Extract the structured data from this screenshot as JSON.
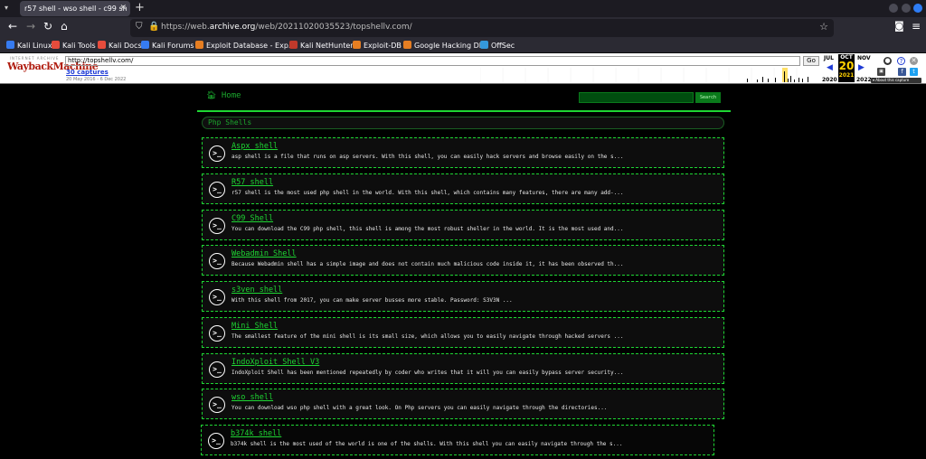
{
  "browser": {
    "tab_title": "r57 shell - wso shell - c99 sh",
    "url_prefix": "https://web.",
    "url_domain": "archive.org",
    "url_rest": "/web/20211020035523/topshellv.com/",
    "bookmarks": [
      {
        "label": "Kali Linux",
        "icon": "kali-icon",
        "color": "#367bf0"
      },
      {
        "label": "Kali Tools",
        "icon": "kali-tools-icon",
        "color": "#e74c3c"
      },
      {
        "label": "Kali Docs",
        "icon": "kali-docs-icon",
        "color": "#e74c3c"
      },
      {
        "label": "Kali Forums",
        "icon": "kali-forums-icon",
        "color": "#367bf0"
      },
      {
        "label": "Exploit Database - Exp...",
        "icon": "exploit-db-icon",
        "color": "#e67e22"
      },
      {
        "label": "Kali NetHunter",
        "icon": "nethunter-icon",
        "color": "#c0392b"
      },
      {
        "label": "Exploit-DB",
        "icon": "exploit-db-icon",
        "color": "#e67e22"
      },
      {
        "label": "Google Hacking DB",
        "icon": "ghdb-icon",
        "color": "#e67e22"
      },
      {
        "label": "OffSec",
        "icon": "offsec-icon",
        "color": "#3498db"
      }
    ]
  },
  "wayback": {
    "logo_top": "INTERNET ARCHIVE",
    "logo_main": "WaybackMachine",
    "url_value": "http://topshellv.com/",
    "go_label": "Go",
    "captures_label": "30 captures",
    "date_range": "20 May 2016 - 6 Dec 2022",
    "prev_month": "JUL",
    "cur_month": "OCT",
    "next_month": "NOV",
    "cur_day": "20",
    "prev_year": "2020",
    "cur_year": "2021",
    "next_year": "2022",
    "about_label": "About this capture"
  },
  "page": {
    "home_label": "Home",
    "search_label": "Search",
    "section_title": "Php Shells",
    "shells": [
      {
        "title": "Aspx shell",
        "desc": "asp shell is a file that runs on asp servers. With this shell, you can easily hack servers and browse easily on the s..."
      },
      {
        "title": "R57 shell",
        "desc": "r57 shell is the most used php shell in the world. With this shell, which contains many features, there are many add-..."
      },
      {
        "title": "C99 Shell",
        "desc": "You can download the C99 php shell, this shell is among the most robust sheller in the world. It is the most used and..."
      },
      {
        "title": "Webadmin Shell",
        "desc": "Because Webadmin shell has a simple image and does not contain much malicious code inside it, it has been observed th..."
      },
      {
        "title": "s3ven shell",
        "desc": "With this shell from 2017, you can make server busses more stable. Password: S3V3N ..."
      },
      {
        "title": "Mini Shell",
        "desc": "The smallest feature of the mini shell is its small size, which allows you to easily navigate through hacked servers ..."
      },
      {
        "title": "IndoXploit Shell V3",
        "desc": "IndoXploit Shell has been mentioned repeatedly by coder who writes that it will you can easily bypass server security..."
      },
      {
        "title": "wso shell",
        "desc": "You can download wso php shell with a great look. On Php servers you can easily navigate through the directories..."
      },
      {
        "title": "b374k shell",
        "desc": "b374k shell is the most used of the world is one of the shells. With this shell you can easily navigate through the s..."
      }
    ]
  }
}
